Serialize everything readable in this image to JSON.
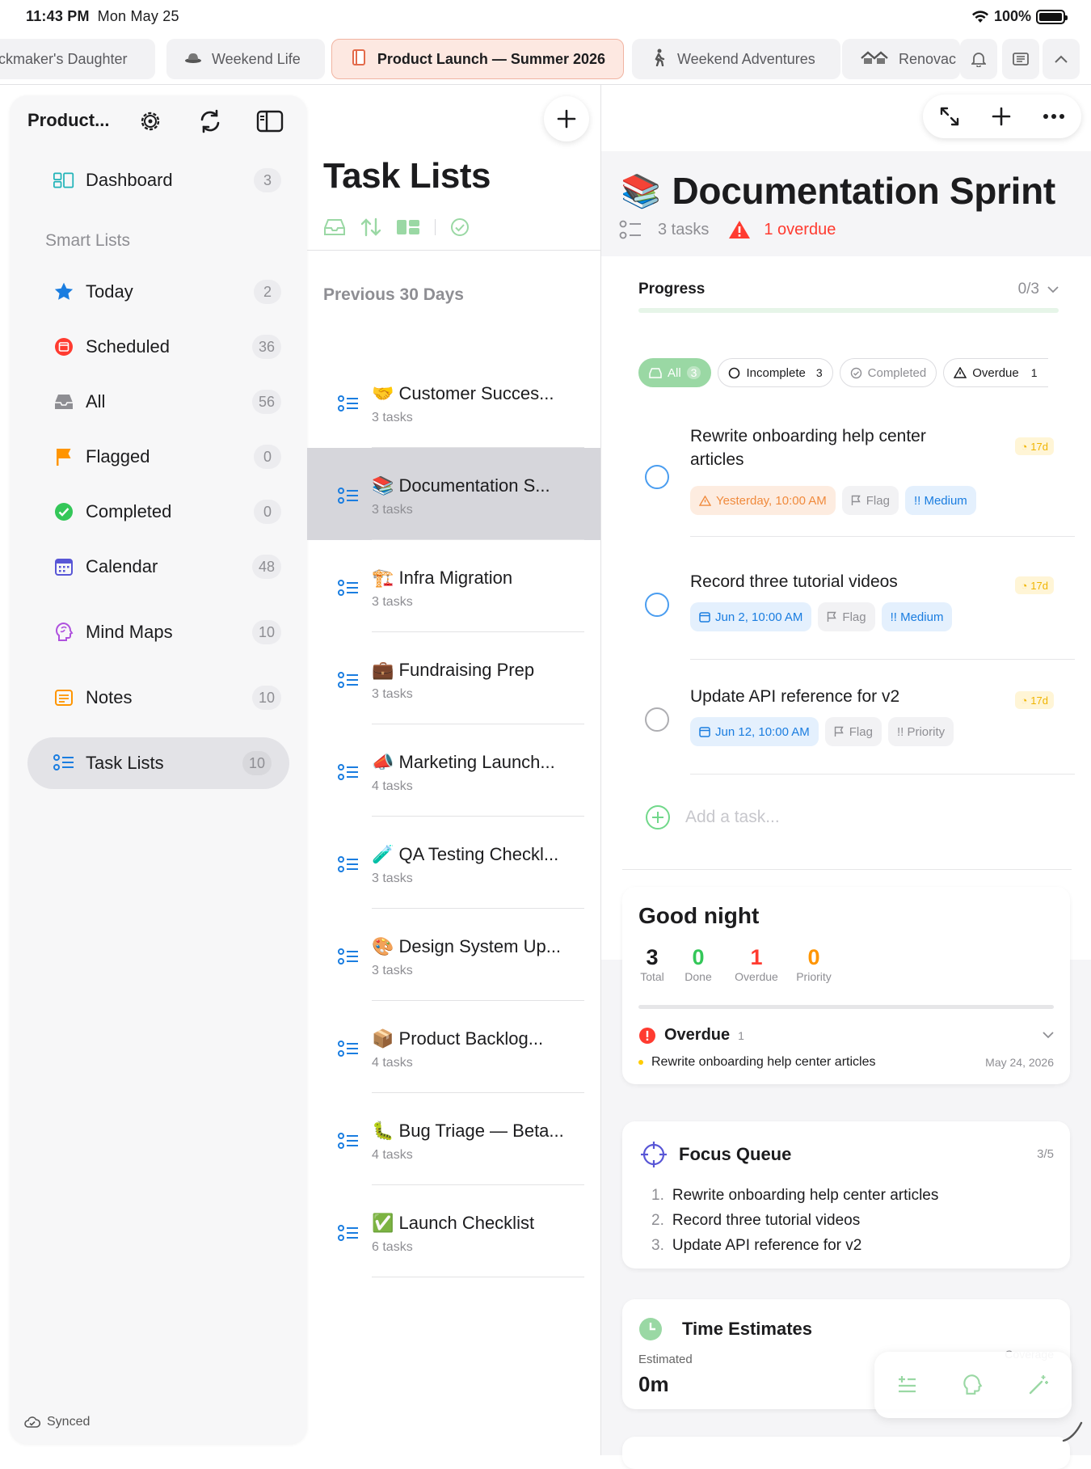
{
  "status": {
    "time": "11:43 PM",
    "date": "Mon May 25",
    "battery": "100%"
  },
  "tabs": [
    {
      "label": "ckmaker's Daughter",
      "icon": ""
    },
    {
      "label": "Weekend Life",
      "icon": "hat-icon"
    },
    {
      "label": "Product Launch — Summer 2026",
      "icon": "notebook-icon",
      "active": true
    },
    {
      "label": "Weekend Adventures",
      "icon": "hiker-icon"
    },
    {
      "label": "Renovac",
      "icon": "house-icon"
    }
  ],
  "sidebar": {
    "title": "Product...",
    "section": "Smart Lists",
    "items": [
      {
        "label": "Dashboard",
        "count": "3"
      },
      {
        "label": "Today",
        "count": "2"
      },
      {
        "label": "Scheduled",
        "count": "36"
      },
      {
        "label": "All",
        "count": "56"
      },
      {
        "label": "Flagged",
        "count": "0"
      },
      {
        "label": "Completed",
        "count": "0"
      },
      {
        "label": "Calendar",
        "count": "48"
      },
      {
        "label": "Mind Maps",
        "count": "10"
      },
      {
        "label": "Notes",
        "count": "10"
      },
      {
        "label": "Task Lists",
        "count": "10"
      }
    ],
    "synced": "Synced"
  },
  "mid": {
    "title": "Task Lists",
    "section": "Previous 30 Days",
    "lists": [
      {
        "emoji": "🤝",
        "title": "Customer Succes...",
        "sub": "3 tasks"
      },
      {
        "emoji": "📚",
        "title": "Documentation S...",
        "sub": "3 tasks"
      },
      {
        "emoji": "🏗️",
        "title": "Infra Migration",
        "sub": "3 tasks"
      },
      {
        "emoji": "💼",
        "title": "Fundraising Prep",
        "sub": "3 tasks"
      },
      {
        "emoji": "📣",
        "title": "Marketing Launch...",
        "sub": "4 tasks"
      },
      {
        "emoji": "🧪",
        "title": "QA Testing Checkl...",
        "sub": "3 tasks"
      },
      {
        "emoji": "🎨",
        "title": "Design System Up...",
        "sub": "3 tasks"
      },
      {
        "emoji": "📦",
        "title": "Product Backlog...",
        "sub": "4 tasks"
      },
      {
        "emoji": "🐛",
        "title": "Bug Triage — Beta...",
        "sub": "4 tasks"
      },
      {
        "emoji": "✅",
        "title": "Launch Checklist",
        "sub": "6 tasks"
      }
    ]
  },
  "detail": {
    "emoji": "📚",
    "title": "Documentation Sprint",
    "tasks_count": "3 tasks",
    "overdue": "1 overdue",
    "progress_label": "Progress",
    "progress_value": "0/3",
    "progress_fraction": 0,
    "filters": [
      {
        "label": "All",
        "count": "3"
      },
      {
        "label": "Incomplete",
        "count": "3"
      },
      {
        "label": "Completed",
        "count": ""
      },
      {
        "label": "Overdue",
        "count": "1"
      }
    ],
    "tasks": [
      {
        "title": "Rewrite onboarding help center articles",
        "badge": "17d",
        "due": "Yesterday, 10:00 AM",
        "flag": "Flag",
        "priority": "!! Medium"
      },
      {
        "title": "Record three tutorial videos",
        "badge": "17d",
        "due": "Jun 2, 10:00 AM",
        "flag": "Flag",
        "priority": "!! Medium"
      },
      {
        "title": "Update API reference for v2",
        "badge": "17d",
        "due": "Jun 12, 10:00 AM",
        "flag": "Flag",
        "priority": "!! Priority"
      }
    ],
    "add_placeholder": "Add a task..."
  },
  "goodnight": {
    "title": "Good night",
    "stats": [
      {
        "value": "3",
        "label": "Total",
        "color": "#1c1c1e"
      },
      {
        "value": "0",
        "label": "Done",
        "color": "#34c759"
      },
      {
        "value": "1",
        "label": "Overdue",
        "color": "#ff3b30"
      },
      {
        "value": "0",
        "label": "Priority",
        "color": "#ff9500"
      }
    ],
    "overdue_label": "Overdue",
    "overdue_count": "1",
    "overdue_item": "Rewrite onboarding help center articles",
    "overdue_date": "May 24, 2026"
  },
  "focus": {
    "title": "Focus Queue",
    "count": "3/5",
    "items": [
      "Rewrite onboarding help center articles",
      "Record three tutorial videos",
      "Update API reference for v2"
    ]
  },
  "estimates": {
    "title": "Time Estimates",
    "sub": "Estimated",
    "value": "0m",
    "coverage": "Coverage"
  },
  "colors": {
    "accent_green": "#34c759",
    "danger": "#ff3b30",
    "warning": "#ff9500",
    "link": "#1a7de0"
  }
}
